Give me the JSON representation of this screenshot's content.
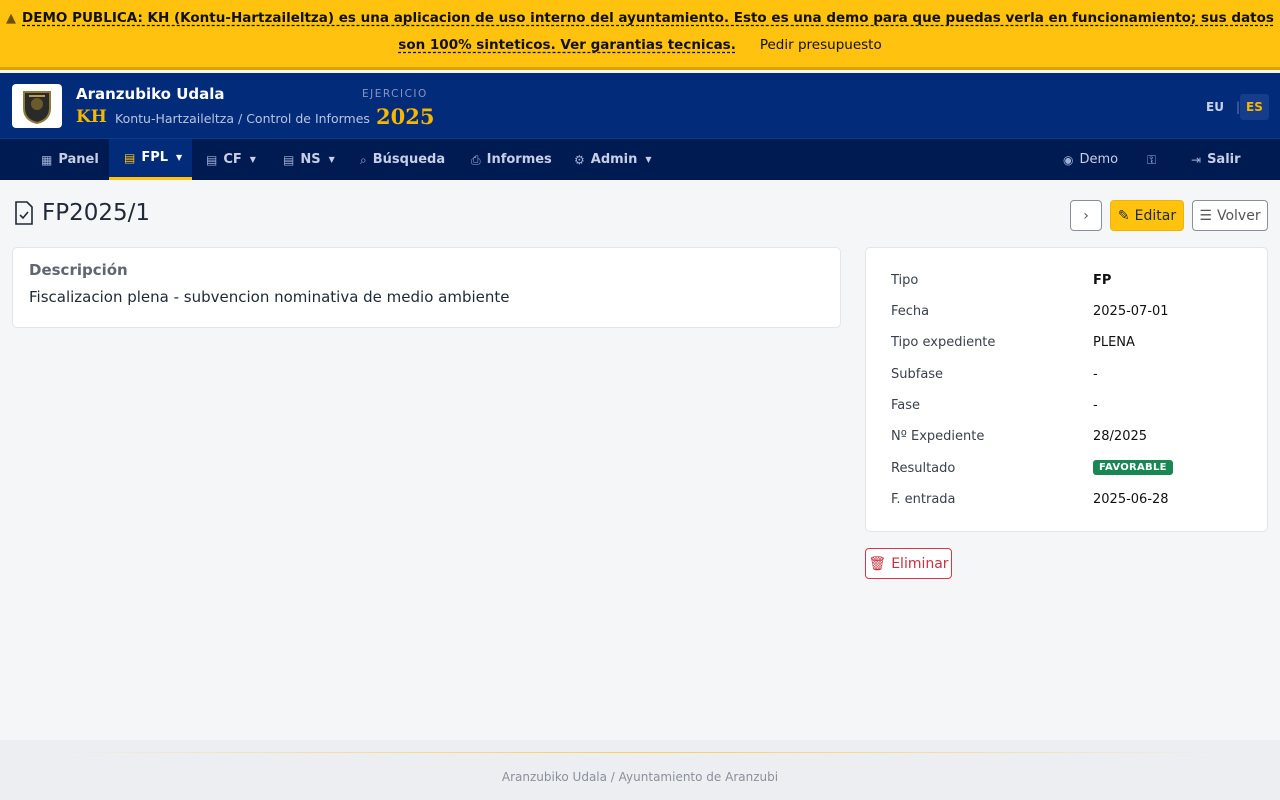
{
  "banner": {
    "message": "DEMO PUBLICA: KH (Kontu-Hartzaileltza) es una aplicacion de uso interno del ayuntamiento. Esto es una demo para que puedas verla en funcionamiento; sus datos son 100% sinteticos. Ver garantias tecnicas.",
    "quote_link": "Pedir presupuesto",
    "warning_icon": "warning-triangle-icon"
  },
  "header": {
    "org_name": "Aranzubiko Udala",
    "app_short": "KH",
    "subtitle": "Kontu-Hartzaileltza / Control de Informes",
    "exercise_label": "EJERCICIO",
    "exercise_year": "2025",
    "lang_eu": "EU",
    "lang_sep": "|",
    "lang_es": "ES"
  },
  "nav": {
    "panel": "Panel",
    "fpl": "FPL",
    "cf": "CF",
    "ns": "NS",
    "busqueda": "Búsqueda",
    "informes": "Informes",
    "admin": "Admin",
    "user": "Demo",
    "salir": "Salir"
  },
  "page": {
    "title": "FP2025/1",
    "edit_label": "Editar",
    "back_label": "Volver",
    "delete_label": "Eliminar"
  },
  "description": {
    "heading": "Descripción",
    "text": "Fiscalizacion plena - subvencion nominativa de medio ambiente"
  },
  "details": [
    {
      "label": "Tipo",
      "value": "FP"
    },
    {
      "label": "Fecha",
      "value": "2025-07-01"
    },
    {
      "label": "Tipo expediente",
      "value": "PLENA"
    },
    {
      "label": "Subfase",
      "value": "-"
    },
    {
      "label": "Fase",
      "value": "-"
    },
    {
      "label": "Nº Expediente",
      "value": "28/2025"
    },
    {
      "label": "Resultado",
      "value": "FAVORABLE"
    },
    {
      "label": "F. entrada",
      "value": "2025-06-28"
    }
  ],
  "colors": {
    "accent": "#ffc20e",
    "header": "#022b7a",
    "nav": "#001a52",
    "success": "#198754",
    "danger": "#dc3545"
  },
  "footer": {
    "text": "Aranzubiko Udala / Ayuntamiento de Aranzubi"
  }
}
